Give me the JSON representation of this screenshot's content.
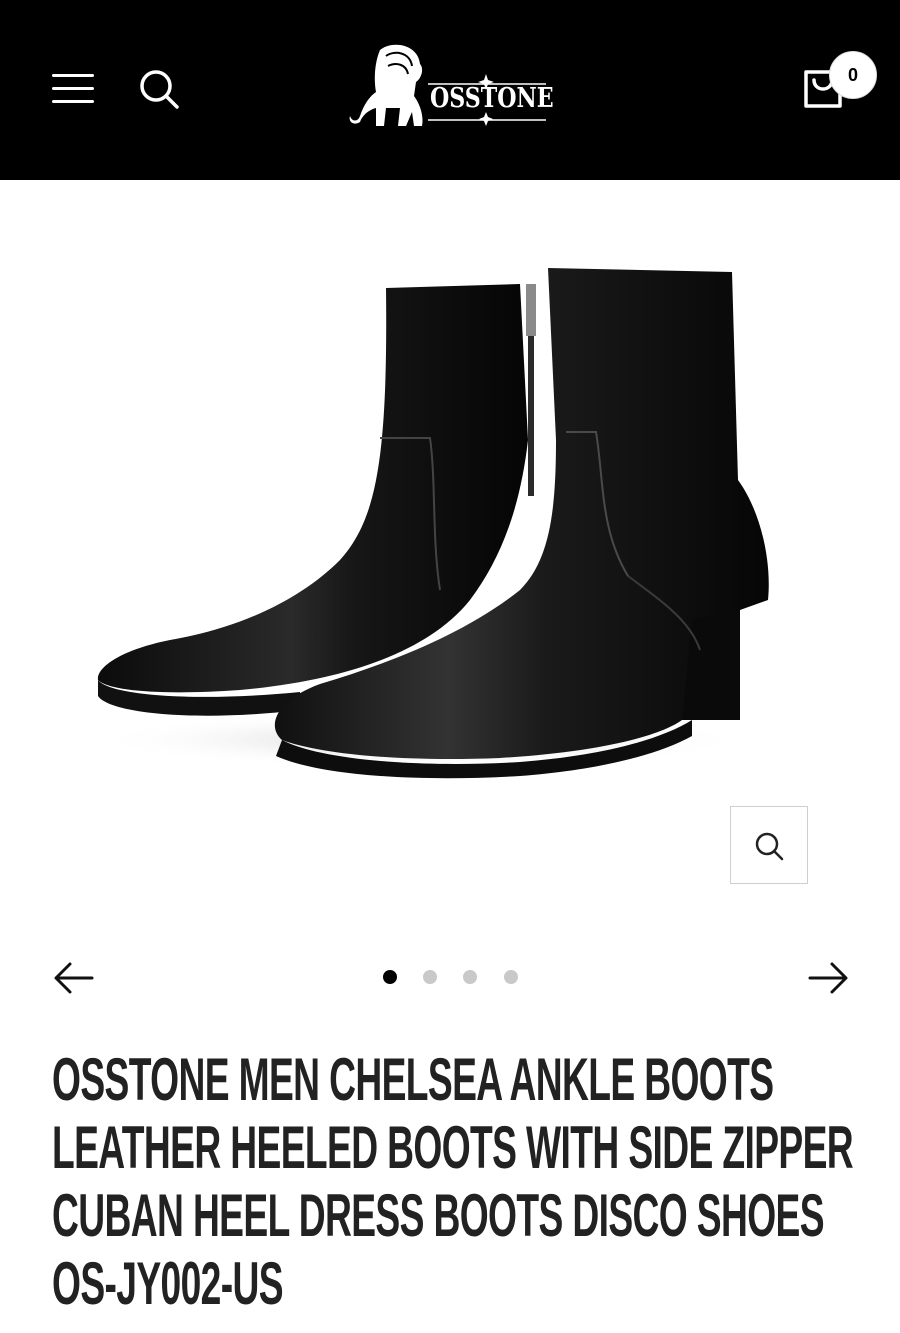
{
  "header": {
    "brand": "OSSTONE",
    "cart_count": "0"
  },
  "gallery": {
    "slide_count": 4,
    "active_index": 0
  },
  "product": {
    "title": "OSSTONE MEN CHELSEA ANKLE BOOTS LEATHER HEELED BOOTS WITH SIDE ZIPPER CUBAN HEEL DRESS BOOTS DISCO SHOES OS-JY002-US"
  },
  "colors": {
    "header_bg": "#000000",
    "title": "#222222",
    "dot_active": "#000000",
    "dot_inactive": "#c9c9c9"
  },
  "icons": {
    "menu": "hamburger-icon",
    "search": "search-icon",
    "cart": "shopping-bag-icon",
    "zoom": "zoom-icon",
    "prev": "arrow-left-icon",
    "next": "arrow-right-icon"
  }
}
